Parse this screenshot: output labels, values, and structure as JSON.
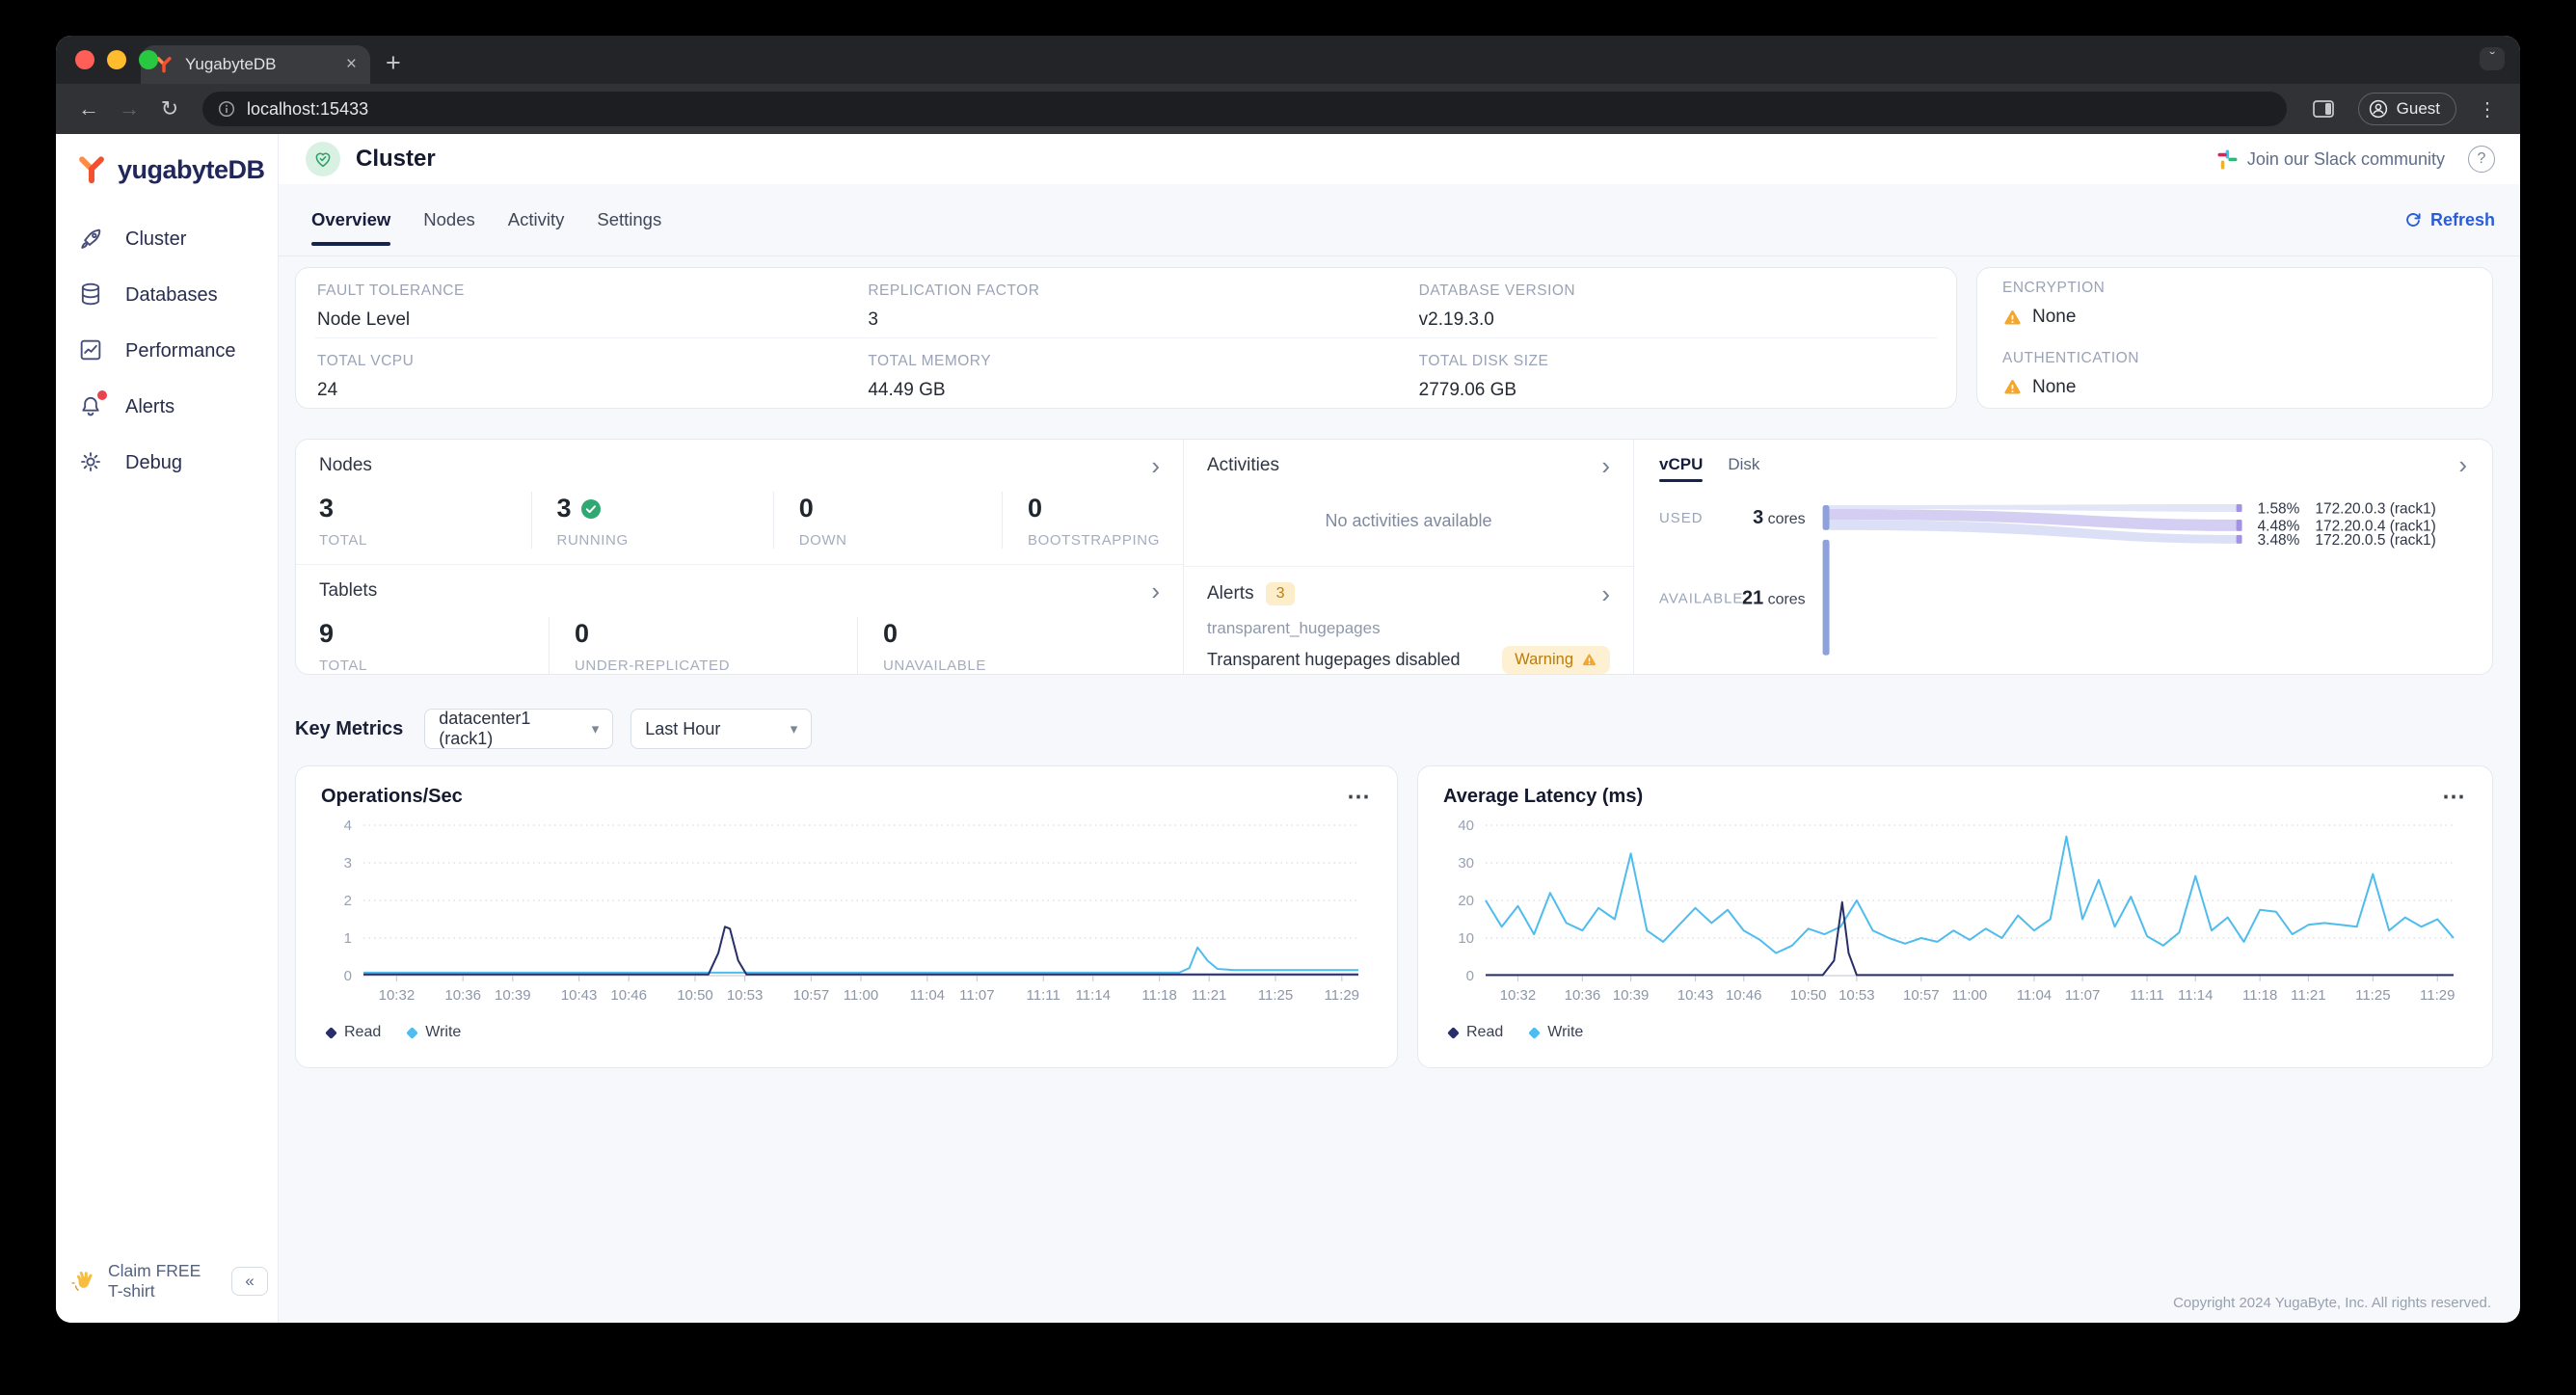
{
  "browser": {
    "tab_title": "YugabyteDB",
    "url": "localhost:15433",
    "profile_label": "Guest"
  },
  "sidebar": {
    "logo_text": "yugabyteDB",
    "items": [
      {
        "label": "Cluster",
        "icon": "rocket-icon",
        "alert_dot": false
      },
      {
        "label": "Databases",
        "icon": "database-icon",
        "alert_dot": false
      },
      {
        "label": "Performance",
        "icon": "performance-icon",
        "alert_dot": false
      },
      {
        "label": "Alerts",
        "icon": "bell-icon",
        "alert_dot": true
      },
      {
        "label": "Debug",
        "icon": "gear-icon",
        "alert_dot": false
      }
    ],
    "claim_label": "Claim FREE T-shirt",
    "collapse_glyph": "«"
  },
  "header": {
    "title": "Cluster",
    "slack_label": "Join our Slack community",
    "help_glyph": "?"
  },
  "tabs": {
    "items": [
      "Overview",
      "Nodes",
      "Activity",
      "Settings"
    ],
    "active": "Overview",
    "refresh_label": "Refresh"
  },
  "cluster_info": {
    "fields": [
      {
        "label": "FAULT TOLERANCE",
        "value": "Node Level"
      },
      {
        "label": "REPLICATION FACTOR",
        "value": "3"
      },
      {
        "label": "DATABASE VERSION",
        "value": "v2.19.3.0"
      },
      {
        "label": "TOTAL VCPU",
        "value": "24"
      },
      {
        "label": "TOTAL MEMORY",
        "value": "44.49 GB"
      },
      {
        "label": "TOTAL DISK SIZE",
        "value": "2779.06 GB"
      }
    ],
    "security": [
      {
        "label": "ENCRYPTION",
        "value": "None"
      },
      {
        "label": "AUTHENTICATION",
        "value": "None"
      }
    ]
  },
  "nodes_panel": {
    "title": "Nodes",
    "stats": [
      {
        "value": "3",
        "label": "TOTAL",
        "check": false
      },
      {
        "value": "3",
        "label": "RUNNING",
        "check": true
      },
      {
        "value": "0",
        "label": "DOWN",
        "check": false
      },
      {
        "value": "0",
        "label": "BOOTSTRAPPING",
        "check": false
      }
    ]
  },
  "tablets_panel": {
    "title": "Tablets",
    "stats": [
      {
        "value": "9",
        "label": "TOTAL",
        "check": false
      },
      {
        "value": "0",
        "label": "UNDER-REPLICATED",
        "check": false
      },
      {
        "value": "0",
        "label": "UNAVAILABLE",
        "check": false
      }
    ]
  },
  "activities_panel": {
    "title": "Activities",
    "empty_text": "No activities available"
  },
  "alerts_panel": {
    "title": "Alerts",
    "count": "3",
    "link": "transparent_hugepages",
    "message": "Transparent hugepages disabled",
    "badge": "Warning"
  },
  "usage_panel": {
    "tabs": [
      "vCPU",
      "Disk"
    ],
    "active_tab": "vCPU",
    "used_label": "USED",
    "used_value": "3",
    "used_unit": "cores",
    "available_label": "AVAILABLE",
    "available_value": "21",
    "available_unit": "cores",
    "nodes": [
      {
        "pct": "1.58%",
        "name": "172.20.0.3 (rack1)"
      },
      {
        "pct": "4.48%",
        "name": "172.20.0.4 (rack1)"
      },
      {
        "pct": "3.48%",
        "name": "172.20.0.5 (rack1)"
      }
    ]
  },
  "key_metrics": {
    "title": "Key Metrics",
    "region_select": "datacenter1 (rack1)",
    "time_select": "Last Hour"
  },
  "footer": {
    "copyright": "Copyright 2024 YugaByte, Inc. All rights reserved."
  },
  "colors": {
    "read_series": "#272e68",
    "write_series": "#4fbcee",
    "accent_blue": "#2b5dd8",
    "warning_amber": "#f3a72e"
  },
  "chart_data": [
    {
      "type": "line",
      "title": "Operations/Sec",
      "x_range_minutes": [
        0,
        60
      ],
      "x_tick_minutes": [
        2,
        6,
        9,
        13,
        16,
        20,
        23,
        27,
        30,
        34,
        37,
        41,
        44,
        48,
        51,
        55,
        59
      ],
      "x_tick_labels": [
        "10:32",
        "10:36",
        "10:39",
        "10:43",
        "10:46",
        "10:50",
        "10:53",
        "10:57",
        "11:00",
        "11:04",
        "11:07",
        "11:11",
        "11:14",
        "11:18",
        "11:21",
        "11:25",
        "11:29"
      ],
      "ylim": [
        0,
        4
      ],
      "yticks": [
        0,
        1,
        2,
        3,
        4
      ],
      "grid": "dotted",
      "legend_position": "bottom-left",
      "series": [
        {
          "name": "Read",
          "color": "#272e68",
          "points": [
            [
              0,
              0.03
            ],
            [
              20.8,
              0.03
            ],
            [
              21.4,
              0.6
            ],
            [
              21.8,
              1.3
            ],
            [
              22.1,
              1.25
            ],
            [
              22.6,
              0.4
            ],
            [
              23.1,
              0.03
            ],
            [
              60,
              0.03
            ]
          ]
        },
        {
          "name": "Write",
          "color": "#4fbcee",
          "points": [
            [
              0,
              0.08
            ],
            [
              49.2,
              0.08
            ],
            [
              49.8,
              0.2
            ],
            [
              50.3,
              0.75
            ],
            [
              50.9,
              0.4
            ],
            [
              51.5,
              0.18
            ],
            [
              52.5,
              0.15
            ],
            [
              60,
              0.15
            ]
          ]
        }
      ]
    },
    {
      "type": "line",
      "title": "Average Latency (ms)",
      "x_range_minutes": [
        0,
        60
      ],
      "x_tick_minutes": [
        2,
        6,
        9,
        13,
        16,
        20,
        23,
        27,
        30,
        34,
        37,
        41,
        44,
        48,
        51,
        55,
        59
      ],
      "x_tick_labels": [
        "10:32",
        "10:36",
        "10:39",
        "10:43",
        "10:46",
        "10:50",
        "10:53",
        "10:57",
        "11:00",
        "11:04",
        "11:07",
        "11:11",
        "11:14",
        "11:18",
        "11:21",
        "11:25",
        "11:29"
      ],
      "ylim": [
        0,
        40
      ],
      "yticks": [
        0,
        10,
        20,
        30,
        40
      ],
      "grid": "dotted",
      "legend_position": "bottom-left",
      "series": [
        {
          "name": "Read",
          "color": "#272e68",
          "points": [
            [
              0,
              0.15
            ],
            [
              20.9,
              0.15
            ],
            [
              21.6,
              4
            ],
            [
              22.1,
              19.5
            ],
            [
              22.5,
              6
            ],
            [
              23,
              0.15
            ],
            [
              60,
              0.15
            ]
          ]
        },
        {
          "name": "Write",
          "color": "#4fbcee",
          "values": [
            20,
            13,
            18.5,
            11,
            22,
            14,
            12,
            18,
            15,
            32.5,
            12,
            9,
            13.5,
            18,
            14,
            17.5,
            12,
            9.5,
            6,
            8,
            12.5,
            11,
            13,
            20,
            12,
            10,
            8.5,
            10,
            9,
            12,
            9.5,
            12.5,
            10,
            16,
            12,
            15,
            37,
            15,
            25.5,
            13,
            21,
            10.5,
            8,
            11.5,
            26.5,
            12,
            15.5,
            9,
            17.5,
            17,
            11,
            13.5,
            14,
            13.5,
            13,
            27,
            12,
            15.5,
            13,
            15,
            10
          ]
        }
      ]
    }
  ]
}
